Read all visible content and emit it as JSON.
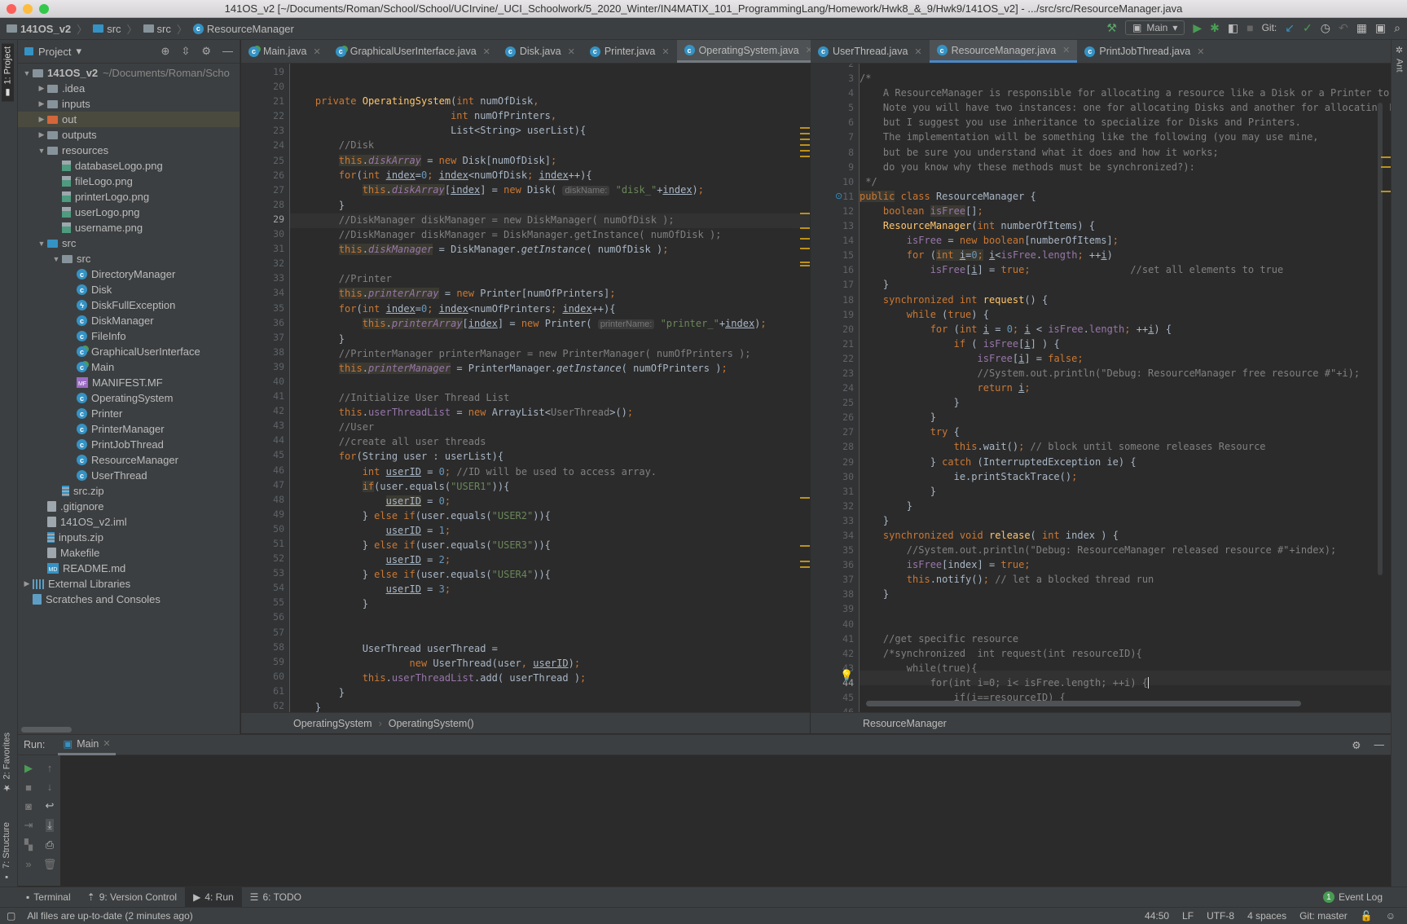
{
  "window": {
    "title": "141OS_v2 [~/Documents/Roman/School/School/UCIrvine/_UCI_Schoolwork/5_2020_Winter/IN4MATIX_101_ProgrammingLang/Homework/Hwk8_&_9/Hwk9/141OS_v2] - .../src/src/ResourceManager.java"
  },
  "navbar": {
    "breadcrumb": [
      "141OS_v2",
      "src",
      "src",
      "ResourceManager"
    ],
    "run_config": "Main",
    "git_label": "Git:"
  },
  "left_strip": {
    "project_tab": "1: Project",
    "favorites_tab": "2: Favorites",
    "structure_tab": "7: Structure"
  },
  "right_strip": {
    "ant_tab": "Ant"
  },
  "project_panel": {
    "title": "Project",
    "root": {
      "name": "141OS_v2",
      "path": "~/Documents/Roman/Scho"
    },
    "items": [
      {
        "label": ".idea",
        "type": "folder",
        "depth": 1,
        "expanded": false
      },
      {
        "label": "inputs",
        "type": "folder",
        "depth": 1,
        "expanded": false
      },
      {
        "label": "out",
        "type": "folder-excluded",
        "depth": 1,
        "expanded": false,
        "selected": true
      },
      {
        "label": "outputs",
        "type": "folder",
        "depth": 1,
        "expanded": false
      },
      {
        "label": "resources",
        "type": "folder",
        "depth": 1,
        "expanded": true
      },
      {
        "label": "databaseLogo.png",
        "type": "image",
        "depth": 2
      },
      {
        "label": "fileLogo.png",
        "type": "image",
        "depth": 2
      },
      {
        "label": "printerLogo.png",
        "type": "image",
        "depth": 2
      },
      {
        "label": "userLogo.png",
        "type": "image",
        "depth": 2
      },
      {
        "label": "username.png",
        "type": "image",
        "depth": 2
      },
      {
        "label": "src",
        "type": "folder-src",
        "depth": 1,
        "expanded": true
      },
      {
        "label": "src",
        "type": "package",
        "depth": 2,
        "expanded": true
      },
      {
        "label": "DirectoryManager",
        "type": "class",
        "depth": 3
      },
      {
        "label": "Disk",
        "type": "class",
        "depth": 3
      },
      {
        "label": "DiskFullException",
        "type": "exception",
        "depth": 3
      },
      {
        "label": "DiskManager",
        "type": "class",
        "depth": 3
      },
      {
        "label": "FileInfo",
        "type": "class",
        "depth": 3
      },
      {
        "label": "GraphicalUserInterface",
        "type": "class-main",
        "depth": 3
      },
      {
        "label": "Main",
        "type": "class-main",
        "depth": 3
      },
      {
        "label": "MANIFEST.MF",
        "type": "manifest",
        "depth": 3
      },
      {
        "label": "OperatingSystem",
        "type": "class",
        "depth": 3
      },
      {
        "label": "Printer",
        "type": "class",
        "depth": 3
      },
      {
        "label": "PrinterManager",
        "type": "class",
        "depth": 3
      },
      {
        "label": "PrintJobThread",
        "type": "class",
        "depth": 3
      },
      {
        "label": "ResourceManager",
        "type": "class",
        "depth": 3
      },
      {
        "label": "UserThread",
        "type": "class",
        "depth": 3
      },
      {
        "label": "src.zip",
        "type": "zip",
        "depth": 2
      },
      {
        "label": ".gitignore",
        "type": "file",
        "depth": 1
      },
      {
        "label": "141OS_v2.iml",
        "type": "file",
        "depth": 1
      },
      {
        "label": "inputs.zip",
        "type": "zip",
        "depth": 1
      },
      {
        "label": "Makefile",
        "type": "file",
        "depth": 1
      },
      {
        "label": "README.md",
        "type": "markdown",
        "depth": 1
      },
      {
        "label": "External Libraries",
        "type": "library",
        "depth": 0,
        "expanded": false
      },
      {
        "label": "Scratches and Consoles",
        "type": "scratches",
        "depth": 0
      }
    ]
  },
  "left_tabs": [
    {
      "label": "Main.java",
      "icon": "class-main"
    },
    {
      "label": "GraphicalUserInterface.java",
      "icon": "class-main"
    },
    {
      "label": "Disk.java",
      "icon": "class"
    },
    {
      "label": "Printer.java",
      "icon": "class"
    },
    {
      "label": "OperatingSystem.java",
      "icon": "class",
      "active": true
    }
  ],
  "right_tabs": [
    {
      "label": "UserThread.java",
      "icon": "class"
    },
    {
      "label": "ResourceManager.java",
      "icon": "class",
      "active": true
    },
    {
      "label": "PrintJobThread.java",
      "icon": "class"
    }
  ],
  "left_editor": {
    "first_line": 19,
    "current_line": 29,
    "breadcrumb": [
      "OperatingSystem",
      "OperatingSystem()"
    ]
  },
  "right_editor": {
    "first_line": 3,
    "current_line": 44,
    "breadcrumb": [
      "ResourceManager"
    ]
  },
  "run_panel": {
    "label": "Run:",
    "tab": "Main"
  },
  "bottom_tabs": [
    {
      "label": "Terminal",
      "icon": "terminal"
    },
    {
      "label": "9: Version Control",
      "icon": "vcs"
    },
    {
      "label": "4: Run",
      "icon": "run",
      "active": true
    },
    {
      "label": "6: TODO",
      "icon": "todo"
    }
  ],
  "event_log": {
    "count": "1",
    "label": "Event Log"
  },
  "status": {
    "message": "All files are up-to-date (2 minutes ago)",
    "position": "44:50",
    "line_sep": "LF",
    "encoding": "UTF-8",
    "indent": "4 spaces",
    "branch": "Git: master"
  }
}
